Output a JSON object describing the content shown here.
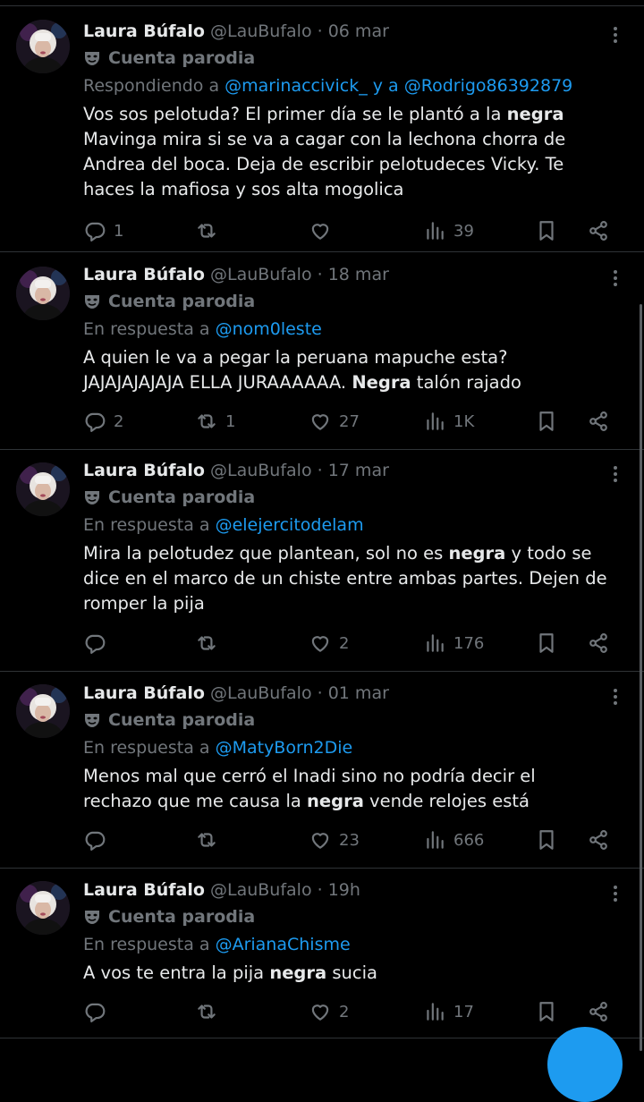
{
  "tweets": [
    {
      "name": "Laura Búfalo",
      "handle": "@LauBufalo",
      "sep": "·",
      "time": "06 mar",
      "parody_label": "Cuenta parodia",
      "reply_prefix": "Respondiendo a ",
      "reply_mentions": "@marinaccivick_ y a @Rodrigo86392879",
      "text_parts": [
        {
          "t": "Vos sos pelotuda? El primer día se le plantó a la ",
          "b": false
        },
        {
          "t": "negra",
          "b": true
        },
        {
          "t": " Mavinga mira si se va a cagar con la lechona chorra de Andrea del boca. Deja de escribir pelotudeces Vicky. Te haces la mafiosa y sos alta mogolica",
          "b": false
        }
      ],
      "replies": "1",
      "reposts": "",
      "likes": "",
      "views": "39"
    },
    {
      "name": "Laura Búfalo",
      "handle": "@LauBufalo",
      "sep": "·",
      "time": "18 mar",
      "parody_label": "Cuenta parodia",
      "reply_prefix": "En respuesta a ",
      "reply_mentions": "@nom0leste",
      "text_parts": [
        {
          "t": "A quien le va a pegar la peruana mapuche esta? JAJAJAJAJAJA ELLA JURAAAAAA. ",
          "b": false
        },
        {
          "t": "Negra",
          "b": true
        },
        {
          "t": " talón rajado",
          "b": false
        }
      ],
      "replies": "2",
      "reposts": "1",
      "likes": "27",
      "views": "1K"
    },
    {
      "name": "Laura Búfalo",
      "handle": "@LauBufalo",
      "sep": "·",
      "time": "17 mar",
      "parody_label": "Cuenta parodia",
      "reply_prefix": "En respuesta a ",
      "reply_mentions": "@elejercitodelam",
      "text_parts": [
        {
          "t": "Mira la pelotudez que plantean, sol no es ",
          "b": false
        },
        {
          "t": "negra",
          "b": true
        },
        {
          "t": " y todo se dice en el marco de un chiste entre ambas partes. Dejen de romper la pija",
          "b": false
        }
      ],
      "replies": "",
      "reposts": "",
      "likes": "2",
      "views": "176"
    },
    {
      "name": "Laura Búfalo",
      "handle": "@LauBufalo",
      "sep": "·",
      "time": "01 mar",
      "parody_label": "Cuenta parodia",
      "reply_prefix": "En respuesta a ",
      "reply_mentions": "@MatyBorn2Die",
      "text_parts": [
        {
          "t": "Menos mal que cerró el Inadi sino no podría decir el rechazo que me causa la ",
          "b": false
        },
        {
          "t": "negra",
          "b": true
        },
        {
          "t": " vende relojes está",
          "b": false
        }
      ],
      "replies": "",
      "reposts": "",
      "likes": "23",
      "views": "666"
    },
    {
      "name": "Laura Búfalo",
      "handle": "@LauBufalo",
      "sep": "·",
      "time": "19h",
      "parody_label": "Cuenta parodia",
      "reply_prefix": "En respuesta a ",
      "reply_mentions": "@ArianaChisme",
      "text_parts": [
        {
          "t": "A vos te entra la pija ",
          "b": false
        },
        {
          "t": "negra",
          "b": true
        },
        {
          "t": " sucia",
          "b": false
        }
      ],
      "replies": "",
      "reposts": "",
      "likes": "2",
      "views": "17"
    }
  ],
  "colors": {
    "background": "#000000",
    "text": "#e7e9ea",
    "muted": "#71767b",
    "link": "#1d9bf0",
    "divider": "#2f3336"
  },
  "icons": [
    "more-icon",
    "parody-mask-icon",
    "reply-icon",
    "repost-icon",
    "like-icon",
    "views-icon",
    "bookmark-icon",
    "share-icon",
    "avatar",
    "compose-button"
  ]
}
